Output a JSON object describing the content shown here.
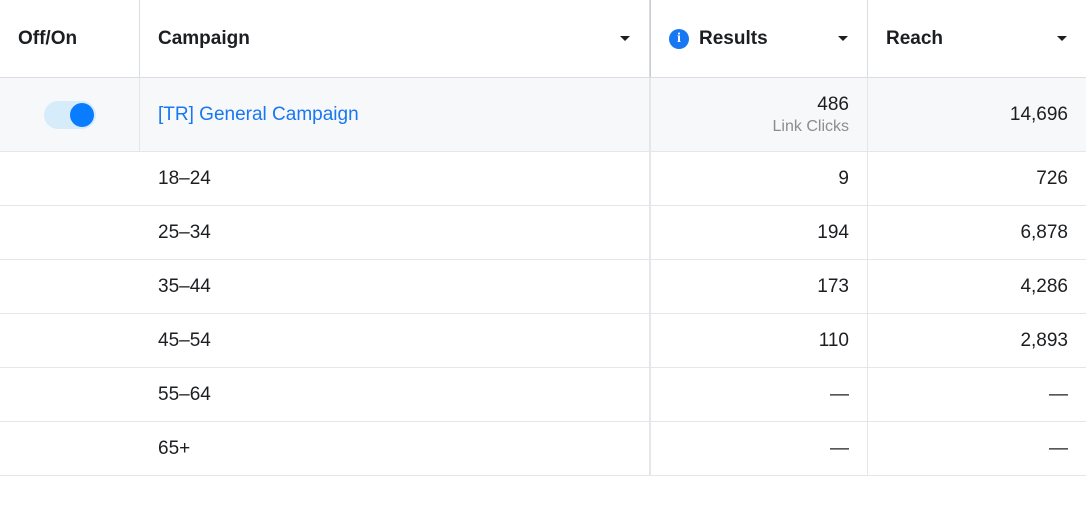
{
  "headers": {
    "toggle": "Off/On",
    "campaign": "Campaign",
    "results": "Results",
    "reach": "Reach"
  },
  "info_icon_glyph": "i",
  "summary": {
    "name": "[TR] General Campaign",
    "results": "486",
    "results_sub": "Link Clicks",
    "reach": "14,696",
    "on": true
  },
  "breakdown": [
    {
      "label": "18–24",
      "results": "9",
      "reach": "726"
    },
    {
      "label": "25–34",
      "results": "194",
      "reach": "6,878"
    },
    {
      "label": "35–44",
      "results": "173",
      "reach": "4,286"
    },
    {
      "label": "45–54",
      "results": "110",
      "reach": "2,893"
    },
    {
      "label": "55–64",
      "results": "—",
      "reach": "—"
    },
    {
      "label": "65+",
      "results": "—",
      "reach": "—"
    }
  ]
}
